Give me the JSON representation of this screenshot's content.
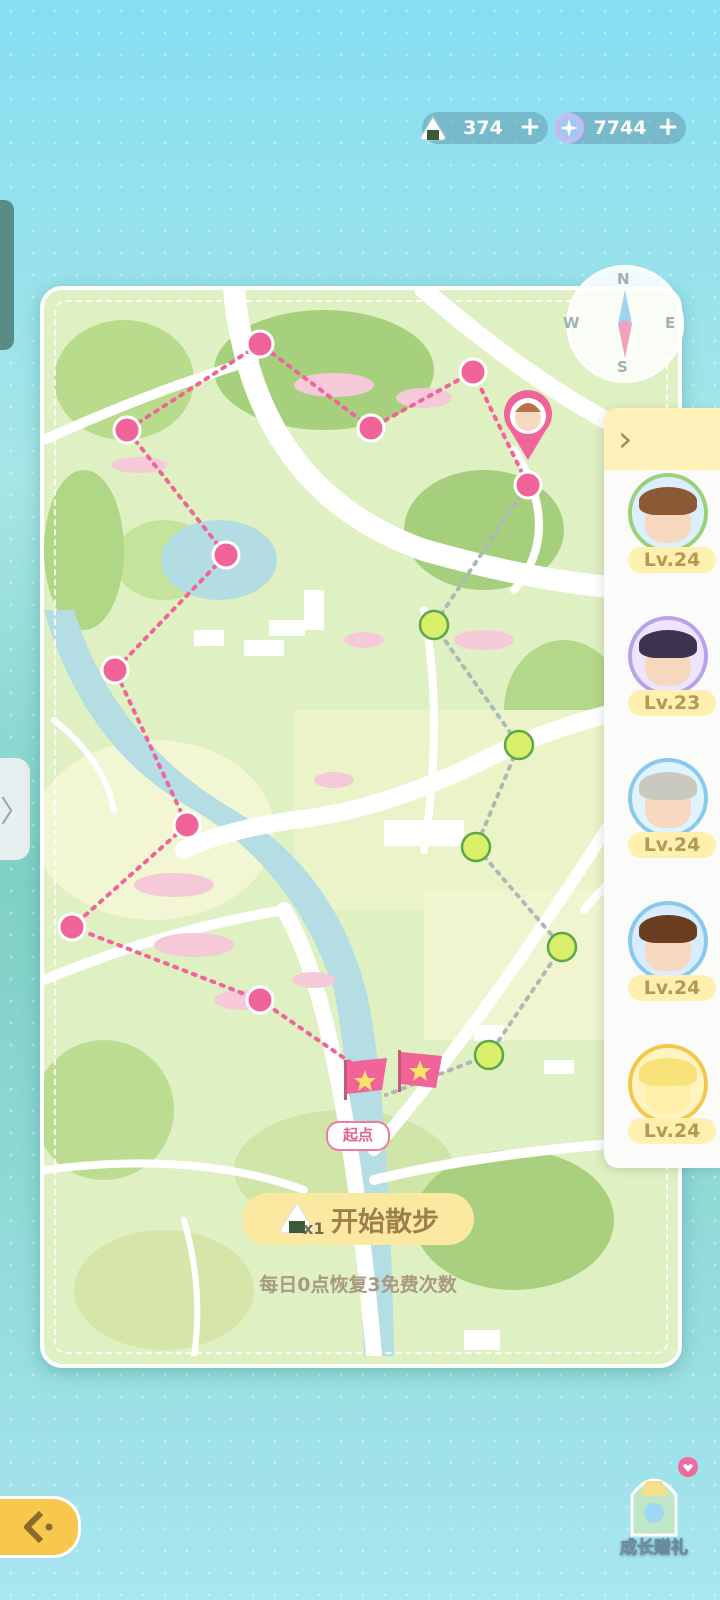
{
  "currency": {
    "rice_count": "374",
    "gem_count": "7744"
  },
  "compass": {
    "n": "N",
    "s": "S",
    "w": "W",
    "e": "E"
  },
  "map": {
    "start_label": "起点"
  },
  "walk": {
    "button_label": "开始散步",
    "cost": "x1",
    "note": "每日0点恢复3免费次数"
  },
  "characters": [
    {
      "level": "Lv.24",
      "ring": "#9bd07a",
      "hair": "#8a5a34"
    },
    {
      "level": "Lv.23",
      "ring": "#b9a3e6",
      "hair": "#3b3350"
    },
    {
      "level": "Lv.24",
      "ring": "#88c9ec",
      "hair": "#c9c9c0"
    },
    {
      "level": "Lv.24",
      "ring": "#88c9ec",
      "hair": "#6b3e22"
    },
    {
      "level": "Lv.24",
      "ring": "#f3c74a",
      "hair": "#f7e27a"
    }
  ],
  "gift": {
    "label": "成长赠礼"
  },
  "colors": {
    "pink_route": "#f0649a",
    "green_route": "#d9ef6a",
    "accent_yellow": "#f7c84d"
  }
}
